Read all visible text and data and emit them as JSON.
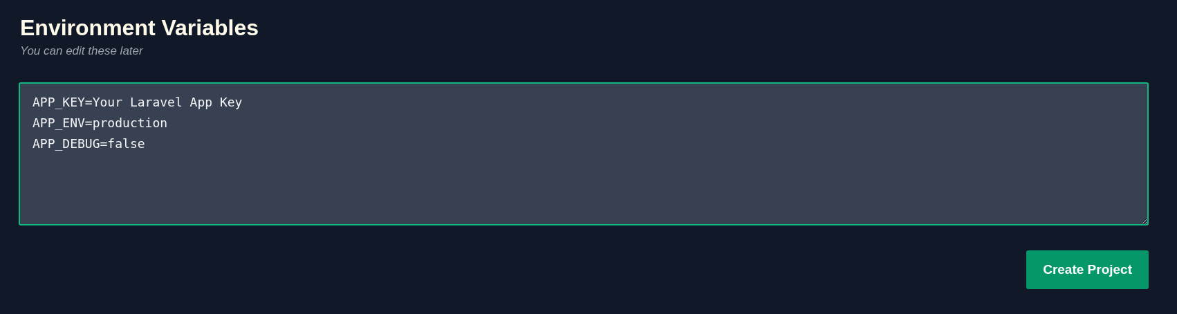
{
  "heading": {
    "title": "Environment Variables",
    "subtitle": "You can edit these later"
  },
  "env_field": {
    "value": "APP_KEY=Your Laravel App Key\nAPP_ENV=production\nAPP_DEBUG=false"
  },
  "buttons": [
    {
      "label": "Create Project"
    }
  ]
}
